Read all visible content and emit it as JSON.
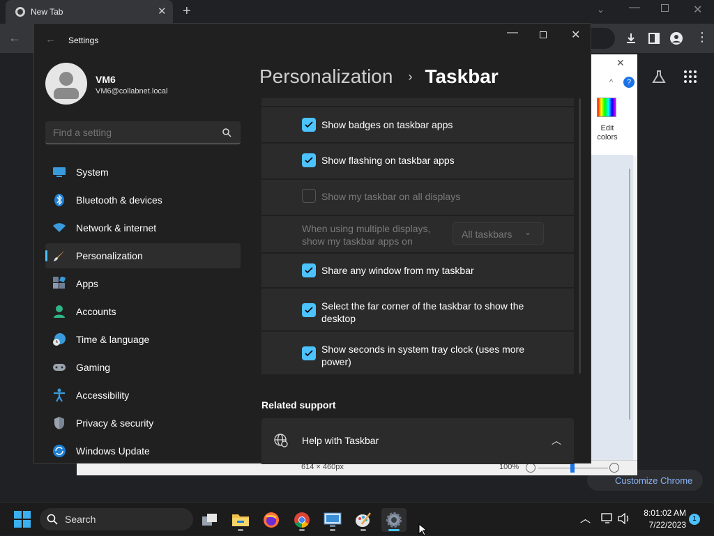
{
  "chrome": {
    "tab_title": "New Tab",
    "customize_label": "Customize Chrome"
  },
  "paint": {
    "edit_colors": "Edit colors",
    "dimensions": "614 × 460px",
    "zoom": "100%"
  },
  "settings": {
    "window_title": "Settings",
    "user": {
      "name": "VM6",
      "email": "VM6@collabnet.local"
    },
    "search": {
      "placeholder": "Find a setting"
    },
    "breadcrumb": {
      "parent": "Personalization",
      "current": "Taskbar"
    },
    "nav": [
      {
        "label": "System",
        "icon": "monitor-icon"
      },
      {
        "label": "Bluetooth & devices",
        "icon": "bluetooth-icon"
      },
      {
        "label": "Network & internet",
        "icon": "wifi-icon"
      },
      {
        "label": "Personalization",
        "icon": "brush-icon",
        "active": true
      },
      {
        "label": "Apps",
        "icon": "apps-icon"
      },
      {
        "label": "Accounts",
        "icon": "person-icon"
      },
      {
        "label": "Time & language",
        "icon": "globe-clock-icon"
      },
      {
        "label": "Gaming",
        "icon": "gamepad-icon"
      },
      {
        "label": "Accessibility",
        "icon": "accessibility-icon"
      },
      {
        "label": "Privacy & security",
        "icon": "shield-icon"
      },
      {
        "label": "Windows Update",
        "icon": "update-icon"
      }
    ],
    "options": [
      {
        "label": "Show badges on taskbar apps",
        "checked": true,
        "enabled": true
      },
      {
        "label": "Show flashing on taskbar apps",
        "checked": true,
        "enabled": true
      },
      {
        "label": "Show my taskbar on all displays",
        "checked": false,
        "enabled": false
      },
      {
        "label": "Share any window from my taskbar",
        "checked": true,
        "enabled": true
      },
      {
        "label": "Select the far corner of the taskbar to show the desktop",
        "checked": true,
        "enabled": true
      },
      {
        "label": "Show seconds in system tray clock (uses more power)",
        "checked": true,
        "enabled": true
      }
    ],
    "multi_display": {
      "label": "When using multiple displays, show my taskbar apps on",
      "value": "All taskbars"
    },
    "related_support": {
      "heading": "Related support",
      "help_label": "Help with Taskbar"
    }
  },
  "taskbar": {
    "search_label": "Search",
    "clock": {
      "time": "8:01:02 AM",
      "date": "7/22/2023"
    },
    "notification_count": "1",
    "apps": [
      "task-view-icon",
      "file-explorer-icon",
      "firefox-icon",
      "chrome-icon",
      "remote-desktop-icon",
      "paint-icon",
      "settings-icon"
    ]
  },
  "colors": {
    "accent": "#4cc2ff",
    "window_bg": "#202020",
    "card_bg": "#2b2b2b"
  }
}
